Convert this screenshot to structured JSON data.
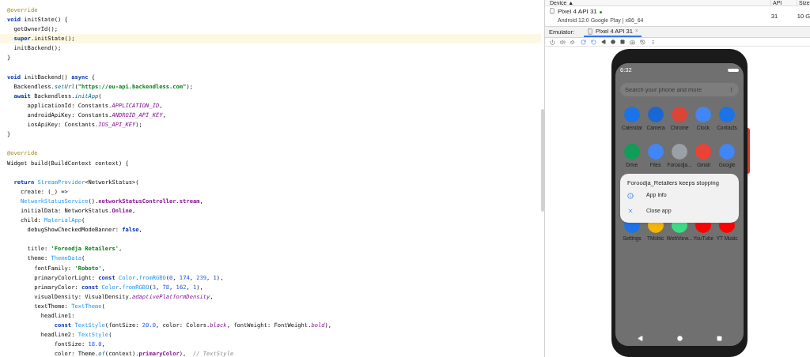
{
  "editor": {
    "lines": [
      {
        "highlighted": false,
        "segments": [
          {
            "text": "@override",
            "kind": "annotation"
          }
        ]
      },
      {
        "highlighted": false,
        "segments": [
          {
            "text": "void",
            "kind": "keyword"
          },
          {
            "text": " initState() {",
            "kind": "plain"
          }
        ]
      },
      {
        "highlighted": false,
        "segments": [
          {
            "text": "  getOwnerId();",
            "kind": "plain"
          }
        ]
      },
      {
        "highlighted": true,
        "segments": [
          {
            "text": "  super",
            "kind": "keyword"
          },
          {
            "text": ".initState();",
            "kind": "plain"
          }
        ]
      },
      {
        "highlighted": false,
        "segments": [
          {
            "text": "  initBackend();",
            "kind": "plain"
          }
        ]
      },
      {
        "highlighted": false,
        "segments": [
          {
            "text": "}",
            "kind": "plain"
          }
        ]
      },
      {
        "highlighted": false
      },
      {
        "highlighted": false,
        "segments": [
          {
            "text": "void",
            "kind": "keyword"
          },
          {
            "text": " initBackend() ",
            "kind": "plain"
          },
          {
            "text": "async",
            "kind": "keyword"
          },
          {
            "text": " {",
            "kind": "plain"
          }
        ]
      },
      {
        "highlighted": false,
        "segments": [
          {
            "text": "  Backendless.",
            "kind": "plain"
          },
          {
            "text": "setUrl",
            "kind": "method"
          },
          {
            "text": "(",
            "kind": "plain"
          },
          {
            "text": "\"https://eu-api.backendless.com\"",
            "kind": "string"
          },
          {
            "text": ");",
            "kind": "plain"
          }
        ]
      },
      {
        "highlighted": false,
        "segments": [
          {
            "text": "  await",
            "kind": "keyword"
          },
          {
            "text": " Backendless.",
            "kind": "plain"
          },
          {
            "text": "initApp",
            "kind": "method"
          },
          {
            "text": "(",
            "kind": "plain"
          }
        ]
      },
      {
        "highlighted": false,
        "segments": [
          {
            "text": "      applicationId: Constants.",
            "kind": "plain"
          },
          {
            "text": "APPLICATION_ID",
            "kind": "constant"
          },
          {
            "text": ",",
            "kind": "plain"
          }
        ]
      },
      {
        "highlighted": false,
        "segments": [
          {
            "text": "      androidApiKey: Constants.",
            "kind": "plain"
          },
          {
            "text": "ANDROID_API_KEY",
            "kind": "constant"
          },
          {
            "text": ",",
            "kind": "plain"
          }
        ]
      },
      {
        "highlighted": false,
        "segments": [
          {
            "text": "      iosApiKey: Constants.",
            "kind": "plain"
          },
          {
            "text": "IOS_API_KEY",
            "kind": "constant"
          },
          {
            "text": ");",
            "kind": "plain"
          }
        ]
      },
      {
        "highlighted": false,
        "segments": [
          {
            "text": "}",
            "kind": "plain"
          }
        ]
      },
      {
        "highlighted": false
      },
      {
        "highlighted": false,
        "segments": [
          {
            "text": "@override",
            "kind": "annotation"
          }
        ]
      },
      {
        "highlighted": false,
        "segments": [
          {
            "text": "Widget build(BuildContext context) {",
            "kind": "plain"
          }
        ]
      },
      {
        "highlighted": false
      },
      {
        "highlighted": false,
        "segments": [
          {
            "text": "  return ",
            "kind": "keyword"
          },
          {
            "text": "StreamProvider",
            "kind": "class"
          },
          {
            "text": "<NetworkStatus>(",
            "kind": "plain"
          }
        ]
      },
      {
        "highlighted": false,
        "segments": [
          {
            "text": "    create: (_) =>",
            "kind": "plain"
          }
        ]
      },
      {
        "highlighted": false,
        "segments": [
          {
            "text": "    NetworkStatusService",
            "kind": "class"
          },
          {
            "text": "().",
            "kind": "plain"
          },
          {
            "text": "networkStatusController",
            "kind": "field"
          },
          {
            "text": ".",
            "kind": "plain"
          },
          {
            "text": "stream",
            "kind": "field"
          },
          {
            "text": ",",
            "kind": "plain"
          }
        ]
      },
      {
        "highlighted": false,
        "segments": [
          {
            "text": "    initialData: NetworkStatus.",
            "kind": "plain"
          },
          {
            "text": "Online",
            "kind": "field"
          },
          {
            "text": ",",
            "kind": "plain"
          }
        ]
      },
      {
        "highlighted": false,
        "segments": [
          {
            "text": "    child: ",
            "kind": "plain"
          },
          {
            "text": "MaterialApp",
            "kind": "class"
          },
          {
            "text": "(",
            "kind": "plain"
          }
        ]
      },
      {
        "highlighted": false,
        "segments": [
          {
            "text": "      debugShowCheckedModeBanner: ",
            "kind": "plain"
          },
          {
            "text": "false",
            "kind": "keyword"
          },
          {
            "text": ",",
            "kind": "plain"
          }
        ]
      },
      {
        "highlighted": false
      },
      {
        "highlighted": false,
        "segments": [
          {
            "text": "      title: ",
            "kind": "plain"
          },
          {
            "text": "'Foroodja Retailers'",
            "kind": "string"
          },
          {
            "text": ",",
            "kind": "plain"
          }
        ]
      },
      {
        "highlighted": false,
        "segments": [
          {
            "text": "      theme: ",
            "kind": "plain"
          },
          {
            "text": "ThemeData",
            "kind": "class"
          },
          {
            "text": "(",
            "kind": "plain"
          }
        ]
      },
      {
        "highlighted": false,
        "segments": [
          {
            "text": "        fontFamily: ",
            "kind": "plain"
          },
          {
            "text": "'Roboto'",
            "kind": "string"
          },
          {
            "text": ",",
            "kind": "plain"
          }
        ]
      },
      {
        "highlighted": false,
        "segments": [
          {
            "text": "        primaryColorLight: ",
            "kind": "plain"
          },
          {
            "text": "const ",
            "kind": "keyword"
          },
          {
            "text": "Color",
            "kind": "class"
          },
          {
            "text": ".",
            "kind": "plain"
          },
          {
            "text": "fromRGBO",
            "kind": "class"
          },
          {
            "text": "(",
            "kind": "plain"
          },
          {
            "text": "0",
            "kind": "number"
          },
          {
            "text": ", ",
            "kind": "plain"
          },
          {
            "text": "174",
            "kind": "number"
          },
          {
            "text": ", ",
            "kind": "plain"
          },
          {
            "text": "239",
            "kind": "number"
          },
          {
            "text": ", ",
            "kind": "plain"
          },
          {
            "text": "1",
            "kind": "number"
          },
          {
            "text": "),",
            "kind": "plain"
          }
        ]
      },
      {
        "highlighted": false,
        "segments": [
          {
            "text": "        primaryColor: ",
            "kind": "plain"
          },
          {
            "text": "const ",
            "kind": "keyword"
          },
          {
            "text": "Color",
            "kind": "class"
          },
          {
            "text": ".",
            "kind": "plain"
          },
          {
            "text": "fromRGBO",
            "kind": "class"
          },
          {
            "text": "(",
            "kind": "plain"
          },
          {
            "text": "3",
            "kind": "number"
          },
          {
            "text": ", ",
            "kind": "plain"
          },
          {
            "text": "78",
            "kind": "number"
          },
          {
            "text": ", ",
            "kind": "plain"
          },
          {
            "text": "162",
            "kind": "number"
          },
          {
            "text": ", ",
            "kind": "plain"
          },
          {
            "text": "1",
            "kind": "number"
          },
          {
            "text": "),",
            "kind": "plain"
          }
        ]
      },
      {
        "highlighted": false,
        "segments": [
          {
            "text": "        visualDensity: VisualDensity.",
            "kind": "plain"
          },
          {
            "text": "adaptivePlatformDensity",
            "kind": "constant"
          },
          {
            "text": ",",
            "kind": "plain"
          }
        ]
      },
      {
        "highlighted": false,
        "segments": [
          {
            "text": "        textTheme: ",
            "kind": "plain"
          },
          {
            "text": "TextTheme",
            "kind": "class"
          },
          {
            "text": "(",
            "kind": "plain"
          }
        ]
      },
      {
        "highlighted": false,
        "segments": [
          {
            "text": "          headline1:",
            "kind": "plain"
          }
        ]
      },
      {
        "highlighted": false,
        "segments": [
          {
            "text": "              const ",
            "kind": "keyword"
          },
          {
            "text": "TextStyle",
            "kind": "class"
          },
          {
            "text": "(fontSize: ",
            "kind": "plain"
          },
          {
            "text": "20.0",
            "kind": "number"
          },
          {
            "text": ", color: Colors.",
            "kind": "plain"
          },
          {
            "text": "black",
            "kind": "constant"
          },
          {
            "text": ", fontWeight: FontWeight.",
            "kind": "plain"
          },
          {
            "text": "bold",
            "kind": "constant"
          },
          {
            "text": "),",
            "kind": "plain"
          }
        ]
      },
      {
        "highlighted": false,
        "segments": [
          {
            "text": "          headline2: ",
            "kind": "plain"
          },
          {
            "text": "TextStyle",
            "kind": "class"
          },
          {
            "text": "(",
            "kind": "plain"
          }
        ]
      },
      {
        "highlighted": false,
        "segments": [
          {
            "text": "              fontSize: ",
            "kind": "plain"
          },
          {
            "text": "18.0",
            "kind": "number"
          },
          {
            "text": ",",
            "kind": "plain"
          }
        ]
      },
      {
        "highlighted": false,
        "segments": [
          {
            "text": "              color: Theme.",
            "kind": "plain"
          },
          {
            "text": "of",
            "kind": "method"
          },
          {
            "text": "(context).",
            "kind": "plain"
          },
          {
            "text": "primaryColor",
            "kind": "field"
          },
          {
            "text": "),  ",
            "kind": "plain"
          },
          {
            "text": "// TextStyle",
            "kind": "comment"
          }
        ]
      }
    ]
  },
  "device_table": {
    "columns": [
      "Device ▲",
      "API",
      "Size"
    ],
    "rows": [
      {
        "name": "Pixel 4 API 31",
        "running": true,
        "subtitle": "Android 12.0 Google Play | x86_64",
        "api": "31",
        "size": "10 G"
      }
    ]
  },
  "emulator": {
    "label": "Emulator:",
    "tabs": [
      {
        "label": "Pixel 4 API 31",
        "close": "×",
        "selected": true
      }
    ]
  },
  "phone": {
    "time": "6:32",
    "search_placeholder": "Search your phone and more",
    "apps": [
      {
        "label": "Calendar",
        "color": "#1a73e8"
      },
      {
        "label": "Camera",
        "color": "#1967d2"
      },
      {
        "label": "Chrome",
        "color": "#db4437"
      },
      {
        "label": "Clock",
        "color": "#4285f4"
      },
      {
        "label": "Contacts",
        "color": "#1a73e8"
      },
      {
        "label": "Drive",
        "color": "#0f9d58"
      },
      {
        "label": "Files",
        "color": "#4285f4"
      },
      {
        "label": "Foroodja...",
        "color": "#9aa0a6"
      },
      {
        "label": "Gmail",
        "color": "#ea4335"
      },
      {
        "label": "Google",
        "color": "#4285f4"
      },
      {
        "label": "Settings",
        "color": "#1a73e8"
      },
      {
        "label": "TMobic",
        "color": "#f4b400"
      },
      {
        "label": "WebView...",
        "color": "#3ddc84"
      },
      {
        "label": "YouTube",
        "color": "#ff0000"
      },
      {
        "label": "YT Music",
        "color": "#ff0000"
      }
    ],
    "dialog": {
      "title": "Foroodja_Retailers keeps stopping",
      "actions": [
        {
          "label": "App info",
          "kind": "info"
        },
        {
          "label": "Close app",
          "kind": "close"
        }
      ]
    }
  }
}
